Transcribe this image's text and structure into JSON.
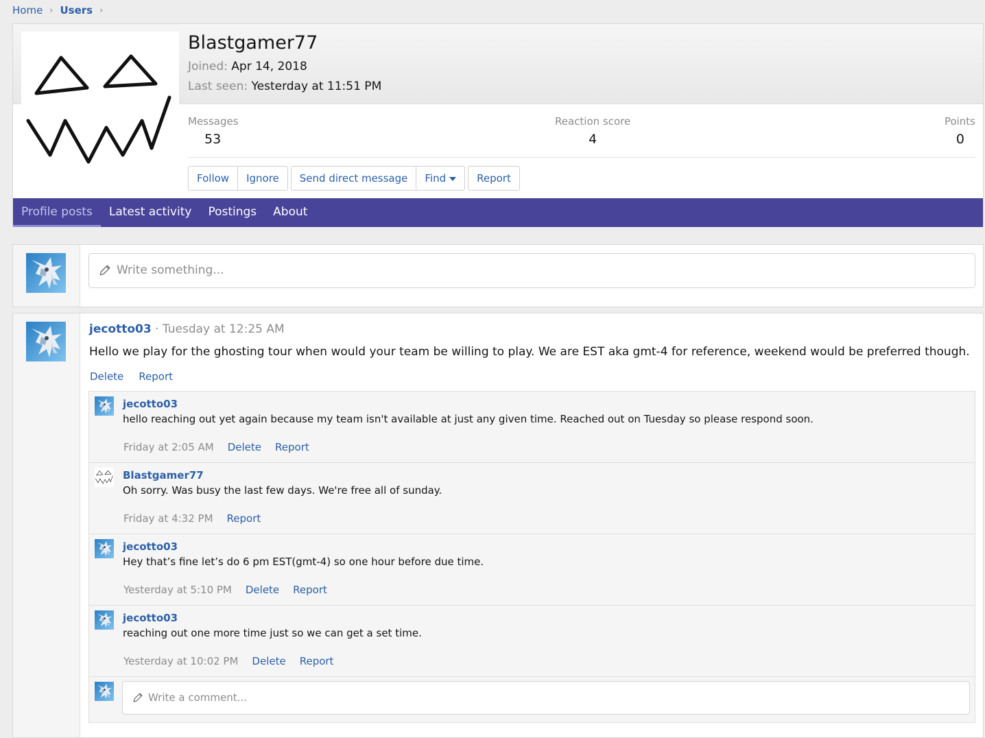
{
  "breadcrumb": {
    "home": "Home",
    "users": "Users"
  },
  "profile": {
    "name": "Blastgamer77",
    "joined_label": "Joined:",
    "joined_value": "Apr 14, 2018",
    "last_seen_label": "Last seen:",
    "last_seen_value": "Yesterday at 11:51 PM",
    "stats": {
      "messages_label": "Messages",
      "messages_value": "53",
      "reaction_label": "Reaction score",
      "reaction_value": "4",
      "points_label": "Points",
      "points_value": "0"
    },
    "buttons": {
      "follow": "Follow",
      "ignore": "Ignore",
      "send_dm": "Send direct message",
      "find": "Find",
      "report": "Report"
    }
  },
  "tabs": [
    "Profile posts",
    "Latest activity",
    "Postings",
    "About"
  ],
  "write_placeholder": "Write something...",
  "post": {
    "user": "jecotto03",
    "time": "Tuesday at 12:25 AM",
    "text": "Hello we play for the ghosting tour when would your team be willing to play. We are EST aka gmt-4 for reference, weekend would be preferred though.",
    "actions": {
      "delete": "Delete",
      "report": "Report"
    }
  },
  "comments": [
    {
      "user": "jecotto03",
      "text": "hello reaching out yet again because my team isn't available at just any given time. Reached out on Tuesday so please respond soon.",
      "time": "Friday at 2:05 AM",
      "delete": "Delete",
      "report": "Report"
    },
    {
      "user": "Blastgamer77",
      "text": "Oh sorry. Was busy the last few days. We're free all of sunday.",
      "time": "Friday at 4:32 PM",
      "report": "Report"
    },
    {
      "user": "jecotto03",
      "text": "Hey that’s fine let’s do 6 pm EST(gmt-4) so one hour before due time.",
      "time": "Yesterday at 5:10 PM",
      "delete": "Delete",
      "report": "Report"
    },
    {
      "user": "jecotto03",
      "text": "reaching out one more time just so we can get a set time.",
      "time": "Yesterday at 10:02 PM",
      "delete": "Delete",
      "report": "Report"
    }
  ],
  "comment_placeholder": "Write a comment...",
  "colors": {
    "tab_bar": "#47449a",
    "link": "#2b5fa8",
    "muted": "#8c8c8c"
  },
  "icons": [
    "chevron-right-icon",
    "caret-down-icon",
    "pencil-icon"
  ]
}
